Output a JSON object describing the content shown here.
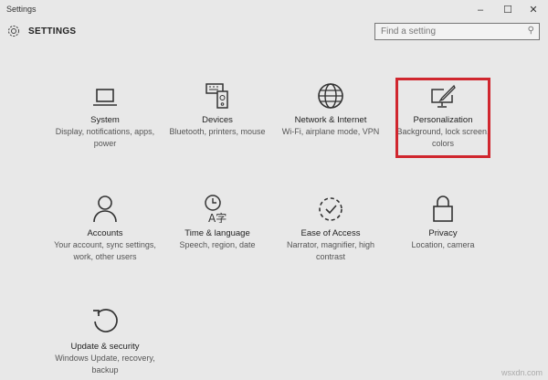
{
  "window": {
    "title": "Settings",
    "controls": {
      "minimize": "–",
      "maximize": "☐",
      "close": "✕"
    }
  },
  "header": {
    "title": "SETTINGS",
    "icon": "gear-icon"
  },
  "search": {
    "placeholder": "Find a setting",
    "icon": "search-icon"
  },
  "tiles": [
    {
      "name": "System",
      "desc": "Display, notifications, apps, power",
      "icon": "laptop-icon"
    },
    {
      "name": "Devices",
      "desc": "Bluetooth, printers, mouse",
      "icon": "keyboard-speaker-icon"
    },
    {
      "name": "Network & Internet",
      "desc": "Wi-Fi, airplane mode, VPN",
      "icon": "globe-icon"
    },
    {
      "name": "Personalization",
      "desc": "Background, lock screen, colors",
      "icon": "monitor-brush-icon",
      "highlighted": true
    },
    {
      "name": "Accounts",
      "desc": "Your account, sync settings, work, other users",
      "icon": "person-icon"
    },
    {
      "name": "Time & language",
      "desc": "Speech, region, date",
      "icon": "clock-language-icon"
    },
    {
      "name": "Ease of Access",
      "desc": "Narrator, magnifier, high contrast",
      "icon": "ease-of-access-icon"
    },
    {
      "name": "Privacy",
      "desc": "Location, camera",
      "icon": "lock-icon"
    },
    {
      "name": "Update & security",
      "desc": "Windows Update, recovery, backup",
      "icon": "refresh-icon"
    }
  ],
  "highlight_color": "#d0262e",
  "watermark": "wsxdn.com"
}
